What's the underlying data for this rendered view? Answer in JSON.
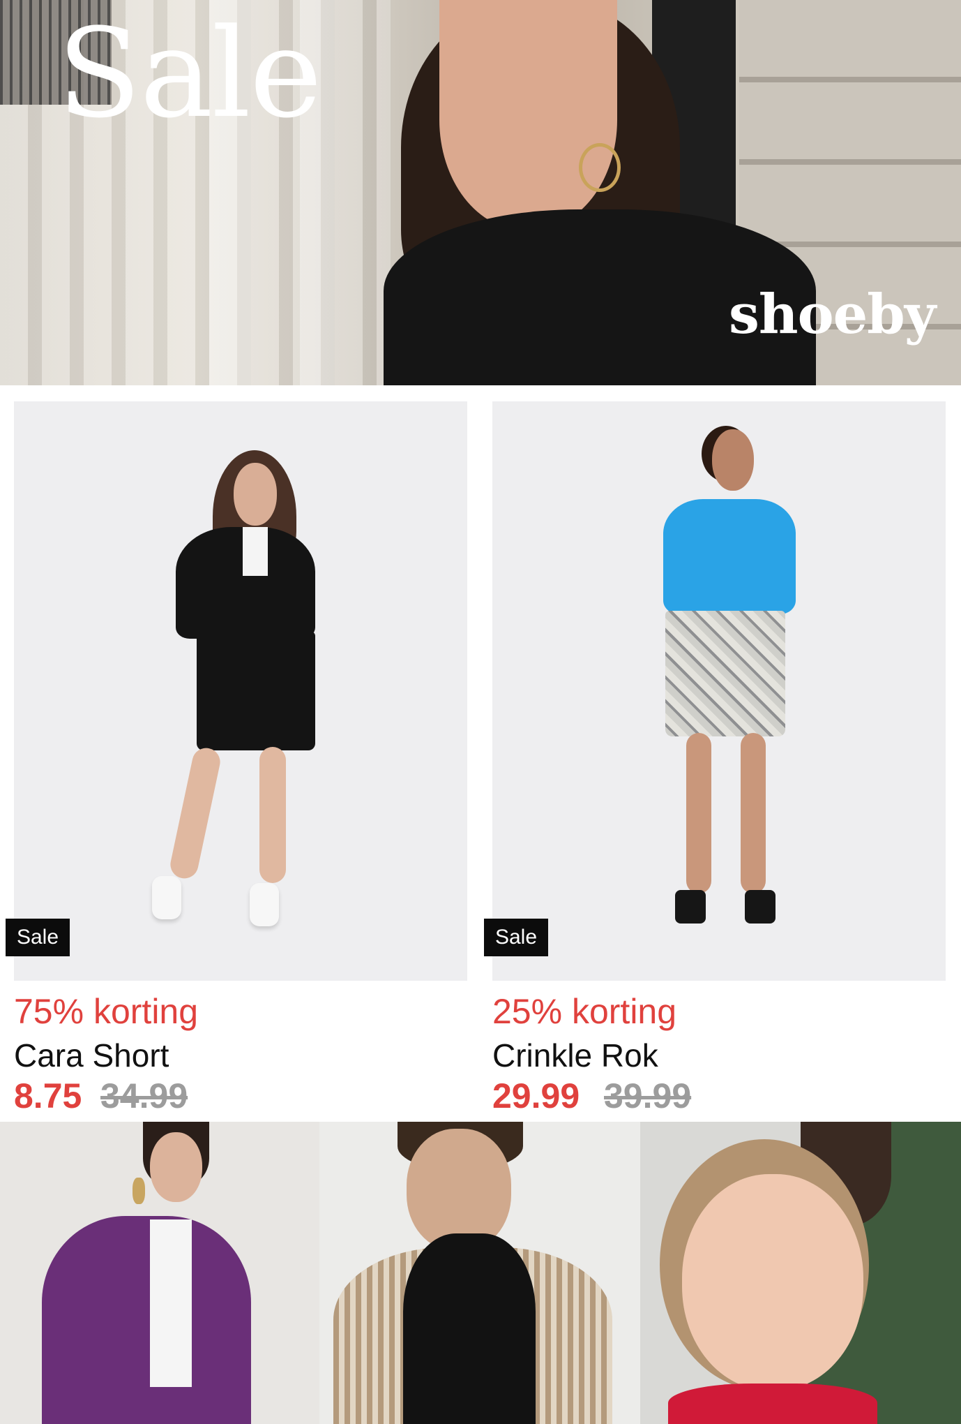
{
  "hero": {
    "title": "Sale",
    "brand": "shoeby"
  },
  "products": [
    {
      "badge": "Sale",
      "discount": "75% korting",
      "name": "Cara Short",
      "price": "8.75",
      "old_price": "34.99"
    },
    {
      "badge": "Sale",
      "discount": "25% korting",
      "name": "Crinkle Rok",
      "price": "29.99",
      "old_price": "39.99"
    }
  ],
  "colors": {
    "discount": "#e0413d",
    "badge_bg": "#0c0c0c",
    "old_price": "#9c9c9c"
  }
}
